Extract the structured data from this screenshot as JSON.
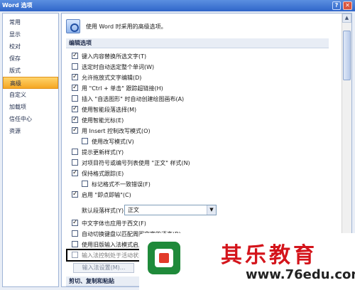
{
  "window": {
    "title": "Word 选项",
    "help_label": "?",
    "close_label": "✕"
  },
  "sidebar": {
    "items": [
      {
        "label": "常用"
      },
      {
        "label": "显示"
      },
      {
        "label": "校对"
      },
      {
        "label": "保存"
      },
      {
        "label": "版式"
      },
      {
        "label": "高级"
      },
      {
        "label": "自定义"
      },
      {
        "label": "加载项"
      },
      {
        "label": "信任中心"
      },
      {
        "label": "资源"
      }
    ],
    "active_index": 5
  },
  "content": {
    "header": "使用 Word 时采用的高级选项。",
    "section_editing": "编辑选项",
    "section_bottom": "剪切、复制和粘贴",
    "options": [
      {
        "label": "键入内容替换所选文字(T)",
        "checked": true
      },
      {
        "label": "选定时自动选定整个单词(W)",
        "checked": false
      },
      {
        "label": "允许拖放式文字编辑(D)",
        "checked": true
      },
      {
        "label": "用 \"Ctrl + 单击\" 跟踪超链接(H)",
        "checked": true
      },
      {
        "label": "插入 \"自选图形\" 时自动创建绘图画布(A)",
        "checked": false
      },
      {
        "label": "使用智能段落选择(M)",
        "checked": true
      },
      {
        "label": "使用智能光标(E)",
        "checked": true
      },
      {
        "label": "用 Insert 控制改写模式(O)",
        "checked": true
      },
      {
        "label": "使用改写模式(V)",
        "checked": false,
        "indent": true
      },
      {
        "label": "提示更新样式(Y)",
        "checked": false
      },
      {
        "label": "对项目符号或编号列表使用 \"正文\" 样式(N)",
        "checked": false
      },
      {
        "label": "保持格式跟踪(E)",
        "checked": true
      },
      {
        "label": "标记格式不一致错误(F)",
        "checked": false,
        "indent": true
      },
      {
        "label": "启用 \"即点即输\"(C)",
        "checked": true
      },
      {
        "label": "中文字体也应用于西文(F)",
        "checked": true
      },
      {
        "label": "自动切换键盘以匹配周围文字的语言(B)",
        "checked": false
      },
      {
        "label": "使用旧版输入法模式启用跟踪(T)",
        "checked": false
      },
      {
        "label": "输入法控制处于活动状态(A)",
        "checked": false
      }
    ],
    "default_style_label": "默认段落样式(Y):",
    "default_style_value": "正文",
    "ime_settings_button": "输入法设置(M)..."
  },
  "watermark": {
    "title": "其乐教育",
    "url": "www.76edu.com"
  },
  "colors": {
    "accent": "#f5a623",
    "watermark_red": "#d4141b",
    "title_bar": "#2f65c9"
  }
}
